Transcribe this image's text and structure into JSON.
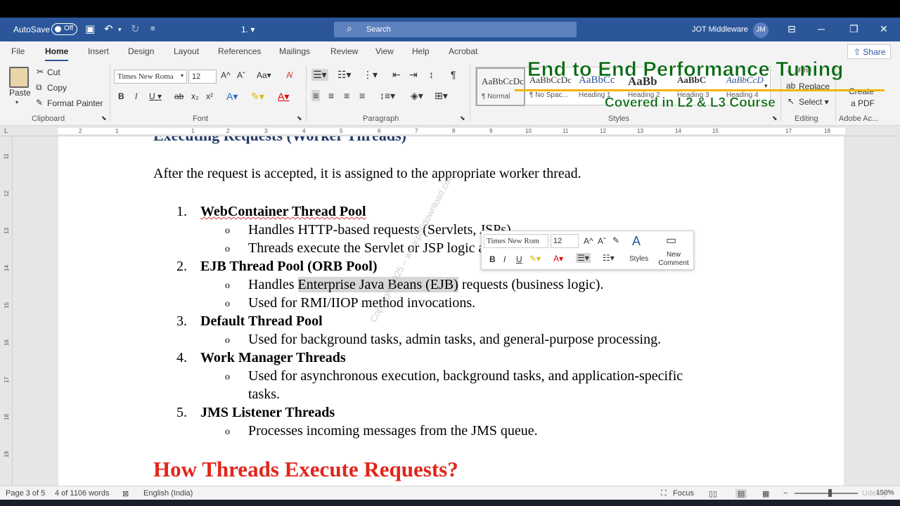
{
  "titlebar": {
    "autosave_label": "AutoSave",
    "autosave_state": "Off",
    "doc_name": "1. ▾",
    "search_placeholder": "Search",
    "user_name": "JOT Middleware",
    "user_initials": "JM"
  },
  "menu": {
    "tabs": [
      "File",
      "Home",
      "Insert",
      "Design",
      "Layout",
      "References",
      "Mailings",
      "Review",
      "View",
      "Help",
      "Acrobat"
    ],
    "active": "Home",
    "share_label": "Share"
  },
  "ribbon": {
    "clipboard": {
      "paste": "Paste",
      "cut": "Cut",
      "copy": "Copy",
      "format_painter": "Format Painter",
      "label": "Clipboard"
    },
    "font": {
      "name": "Times New Roma",
      "size": "12",
      "label": "Font"
    },
    "paragraph_label": "Paragraph",
    "styles": {
      "items": [
        {
          "sample": "AaBbCcDc",
          "name": "¶ Normal"
        },
        {
          "sample": "AaBbCcDc",
          "name": "¶ No Spac..."
        },
        {
          "sample": "AaBbCc",
          "name": "Heading 1"
        },
        {
          "sample": "AaBb",
          "name": "Heading 2"
        },
        {
          "sample": "AaBbC",
          "name": "Heading 3"
        },
        {
          "sample": "AaBbCcD",
          "name": "Heading 4"
        }
      ],
      "label": "Styles"
    },
    "editing": {
      "find": "Find",
      "replace": "Replace",
      "select": "Select ▾",
      "label": "Editing"
    },
    "adobe": {
      "create": "Create",
      "pdf": "a PDF",
      "label": "Adobe Ac..."
    }
  },
  "overlay": {
    "title": "End to End Performance Tuning",
    "subtitle": "Covered in L2 & L3 Course"
  },
  "document": {
    "heading_cut": "Executing Requests (Worker Threads)",
    "intro": "After the request is accepted, it is assigned to the appropriate worker thread.",
    "items": [
      {
        "num": "1.",
        "title": "WebContainer Thread Pool",
        "subs": [
          "Handles HTTP-based requests (Servlets, JSPs).",
          "Threads execute the Servlet or JSP logic and return the response."
        ]
      },
      {
        "num": "2.",
        "title": "EJB Thread Pool (ORB Pool)",
        "subs": [
          "Handles Enterprise Java Beans (EJB) requests (business logic).",
          "Used for RMI/IIOP method invocations."
        ]
      },
      {
        "num": "3.",
        "title": "Default Thread Pool",
        "subs": [
          "Used for background tasks, admin tasks, and general-purpose processing."
        ]
      },
      {
        "num": "4.",
        "title": "Work Manager Threads",
        "subs": [
          "Used for asynchronous execution, background tasks, and application-specific",
          "tasks."
        ]
      },
      {
        "num": "5.",
        "title": "JMS Listener Threads",
        "subs": [
          "Processes incoming messages from the JMS queue."
        ]
      }
    ],
    "sub_highlight_pre": "Handles ",
    "sub_highlight": "Enterprise Java Beans (EJB)",
    "sub_highlight_post": " requests (business logic).",
    "next_heading": "How Threads Execute Requests?",
    "watermark": "Copyright 2025 – www.p30download.com"
  },
  "mini_toolbar": {
    "font": "Times New Rom",
    "size": "12",
    "styles": "Styles",
    "new_comment": "New Comment"
  },
  "statusbar": {
    "page": "Page 3 of 5",
    "words": "4 of 1106 words",
    "language": "English (India)",
    "focus": "Focus",
    "zoom": "150%"
  },
  "colors": {
    "accent": "#2b579a",
    "overlay_green": "#0a6b13",
    "overlay_line": "#f0b400",
    "red_heading": "#e0261b"
  },
  "brand": "Udemy"
}
